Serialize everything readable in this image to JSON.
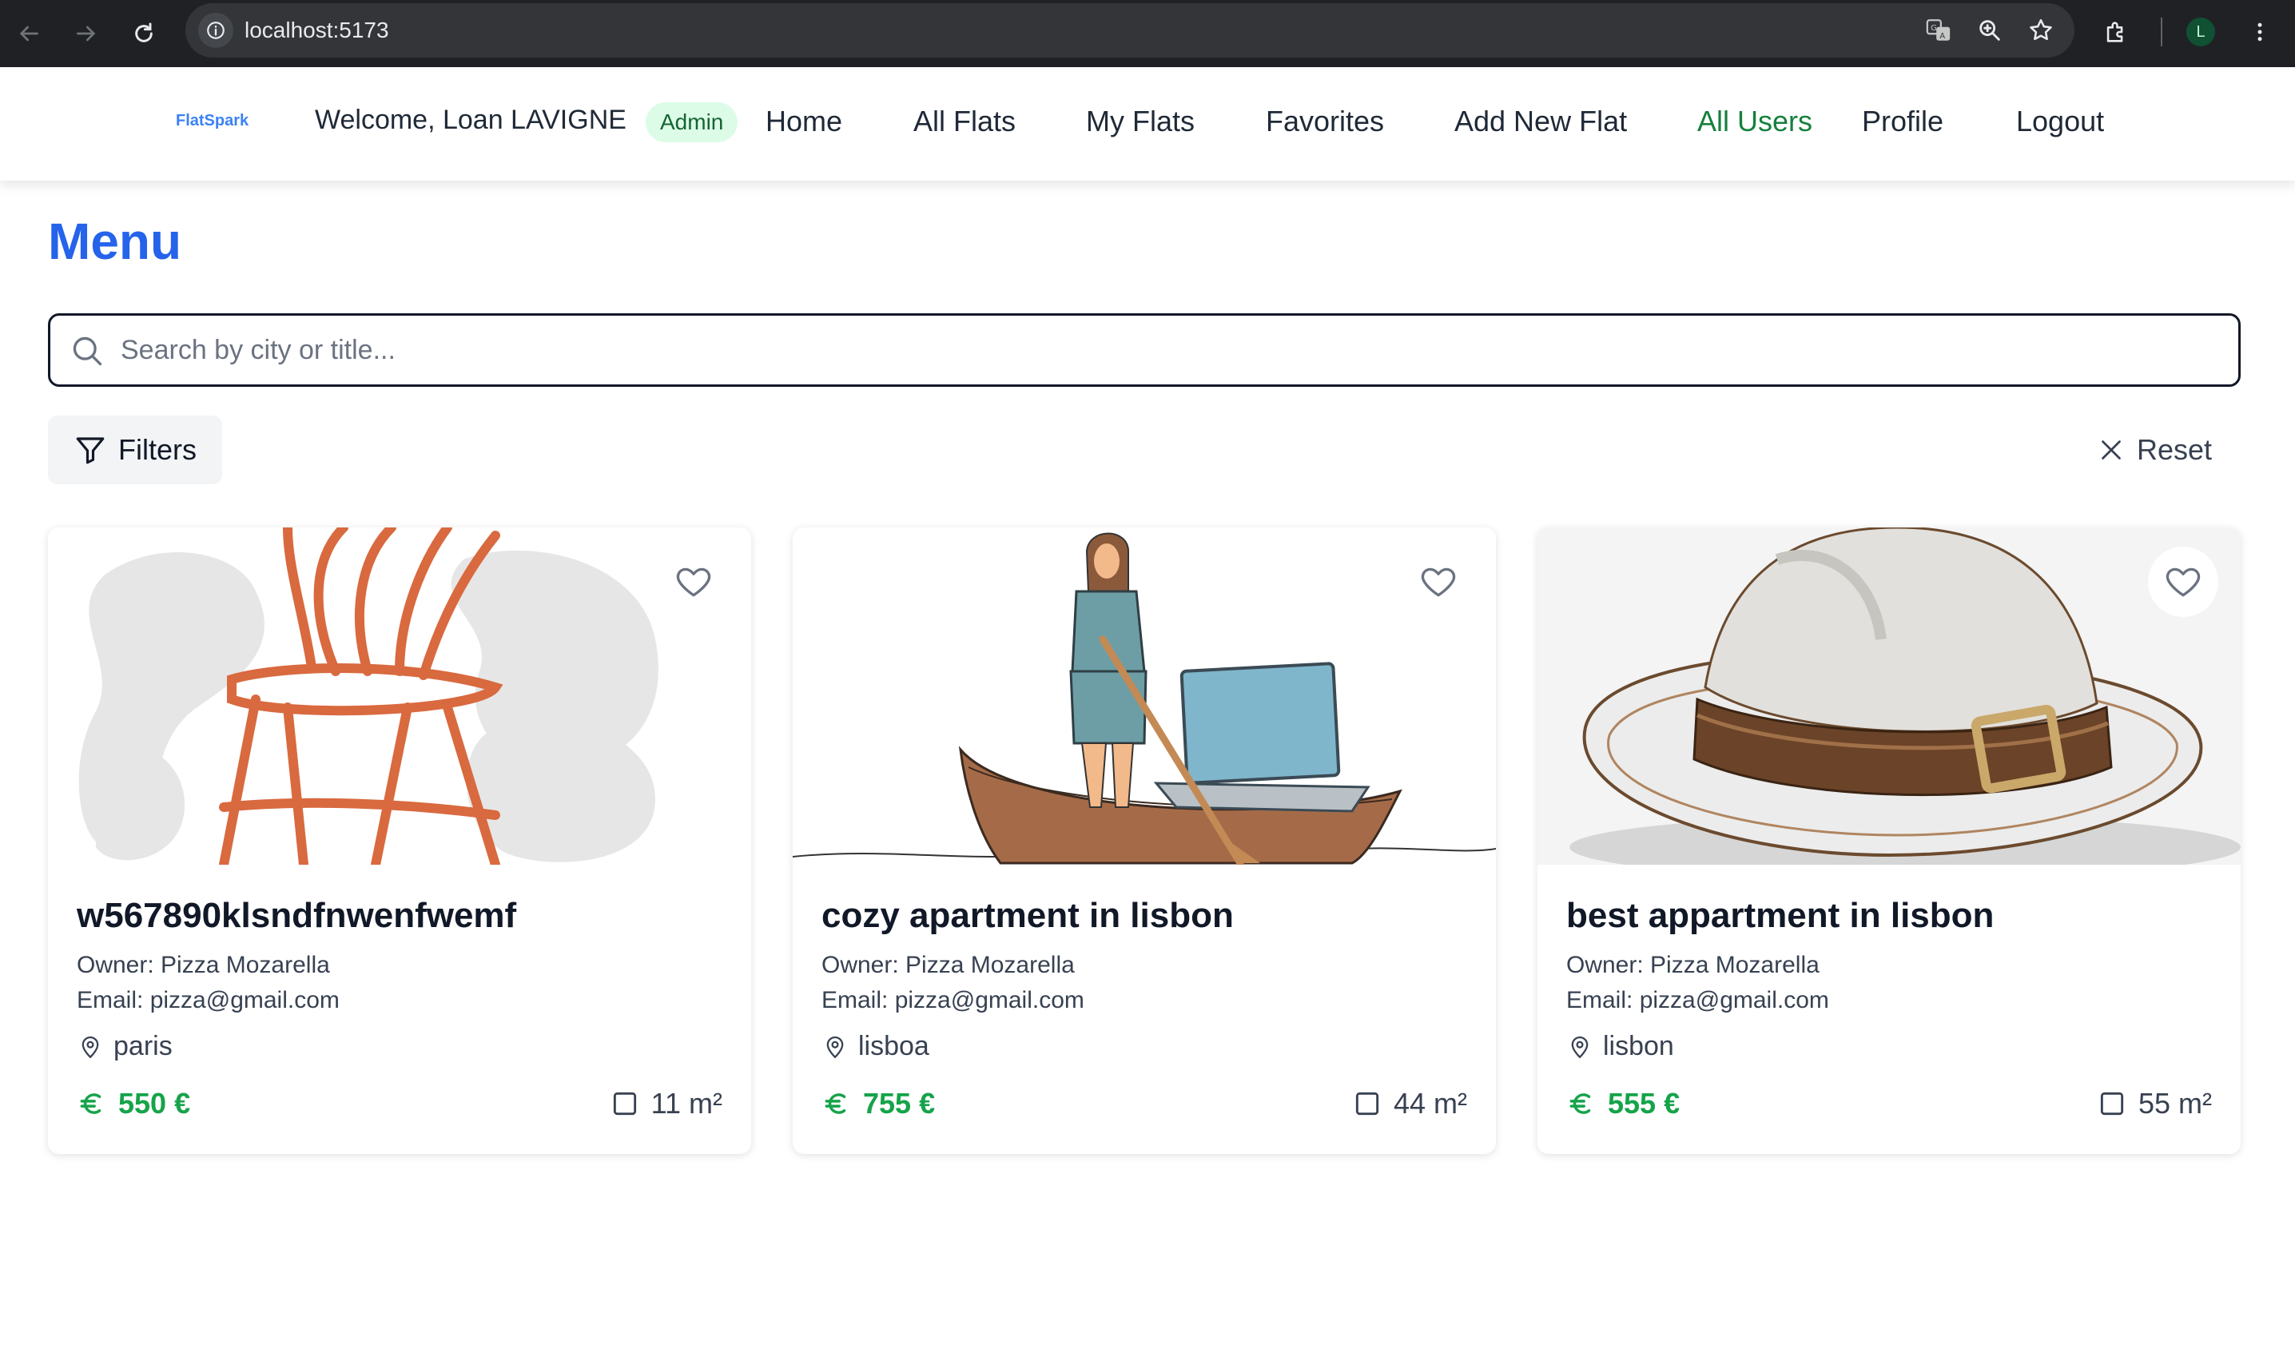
{
  "browser": {
    "url": "localhost:5173",
    "profile_initial": "L"
  },
  "header": {
    "logo": "FlatSpark",
    "welcome": "Welcome, Loan LAVIGNE",
    "role_badge": "Admin",
    "nav": [
      {
        "label": "Home",
        "active": false
      },
      {
        "label": "All Flats",
        "active": false
      },
      {
        "label": "My Flats",
        "active": false
      },
      {
        "label": "Favorites",
        "active": false
      },
      {
        "label": "Add New Flat",
        "active": false
      },
      {
        "label": "All Users",
        "active": true
      },
      {
        "label": "Profile",
        "active": false
      },
      {
        "label": "Logout",
        "active": false
      }
    ]
  },
  "main": {
    "title": "Menu",
    "search_placeholder": "Search by city or title...",
    "filters_label": "Filters",
    "reset_label": "Reset"
  },
  "flats": [
    {
      "title": "w567890klsndfnwenfwemf",
      "owner_label": "Owner:",
      "owner": "Pizza Mozarella",
      "email_label": "Email:",
      "email": "pizza@gmail.com",
      "city": "paris",
      "price": "550 €",
      "area": "11 m²",
      "image": "chair-illustration"
    },
    {
      "title": "cozy apartment in lisbon",
      "owner_label": "Owner:",
      "owner": "Pizza Mozarella",
      "email_label": "Email:",
      "email": "pizza@gmail.com",
      "city": "lisboa",
      "price": "755 €",
      "area": "44 m²",
      "image": "woman-rowing-boat-laptop-illustration"
    },
    {
      "title": "best appartment in lisbon",
      "owner_label": "Owner:",
      "owner": "Pizza Mozarella",
      "email_label": "Email:",
      "email": "pizza@gmail.com",
      "city": "lisbon",
      "price": "555 €",
      "area": "55 m²",
      "image": "hat-illustration"
    }
  ],
  "colors": {
    "title_blue": "#2563eb",
    "active_nav_green": "#15803d",
    "price_green": "#16a34a",
    "badge_bg": "#dcfce7"
  }
}
